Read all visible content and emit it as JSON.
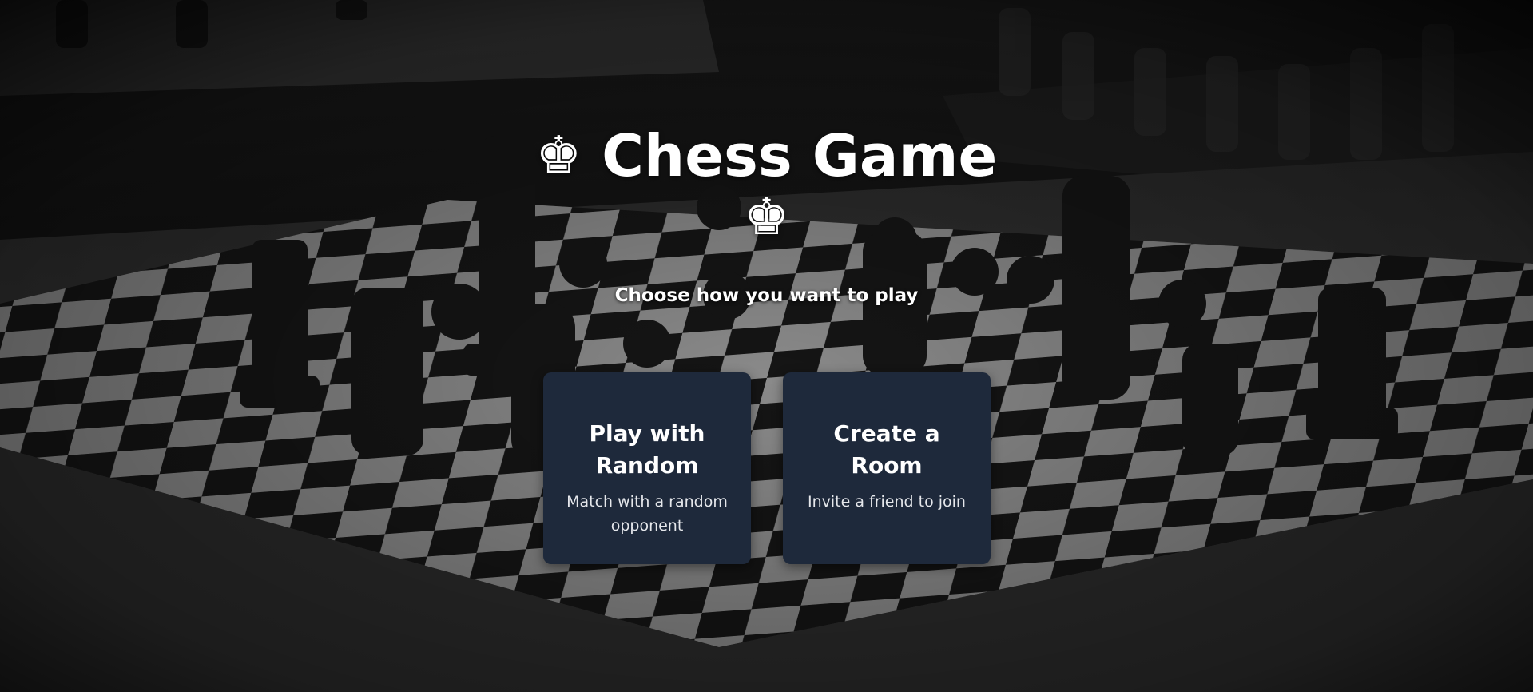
{
  "header": {
    "crown_icon": "♚",
    "title": "Chess Game",
    "subtitle": "Choose how you want to play"
  },
  "options": [
    {
      "title": "Play with Random",
      "description": "Match with a random opponent"
    },
    {
      "title": "Create a Room",
      "description": "Invite a friend to join"
    }
  ],
  "colors": {
    "card_background": "#1e293b",
    "text": "#ffffff"
  },
  "icons": {
    "title_left": "white-king-icon",
    "title_right": "white-king-icon"
  }
}
